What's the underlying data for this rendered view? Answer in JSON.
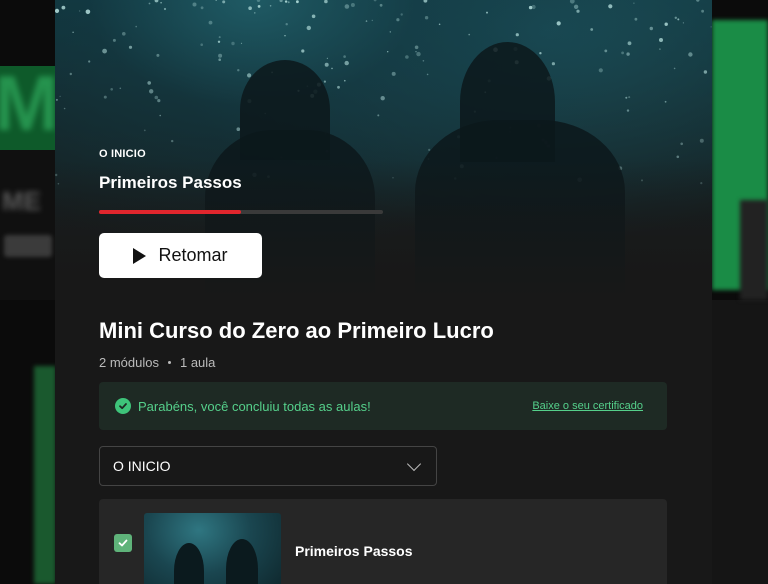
{
  "hero": {
    "section_label": "O INICIO",
    "lesson_title": "Primeiros Passos",
    "progress_fraction": 0.5,
    "resume_label": "Retomar"
  },
  "course": {
    "title": "Mini Curso do Zero ao Primeiro Lucro",
    "modules": "2 módulos",
    "lessons": "1 aula"
  },
  "alert": {
    "message": "Parabéns, você concluiu todas as aulas!",
    "certificate_link": "Baixe o seu certificado",
    "color": "#55d08b"
  },
  "module_select": {
    "selected": "O INICIO"
  },
  "lesson_list": [
    {
      "title": "Primeiros Passos",
      "completed": true
    }
  ],
  "colors": {
    "accent": "#e0262d",
    "success": "#3ec47a",
    "modal_bg": "#181818"
  }
}
